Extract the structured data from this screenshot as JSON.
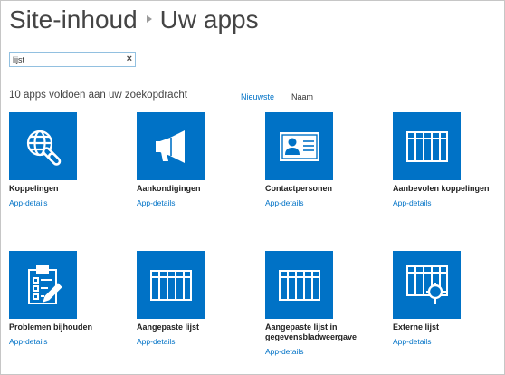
{
  "breadcrumb": {
    "parent": "Site-inhoud",
    "current": "Uw apps"
  },
  "search": {
    "value": "lijst",
    "clear_glyph": "×"
  },
  "results": {
    "count_text": "10 apps voldoen aan uw zoekopdracht",
    "sort_newest": "Nieuwste",
    "sort_name": "Naam"
  },
  "tiles": [
    {
      "name": "Koppelingen",
      "details": "App-details",
      "icon": "globe-link-icon"
    },
    {
      "name": "Aankondigingen",
      "details": "App-details",
      "icon": "megaphone-icon"
    },
    {
      "name": "Contactpersonen",
      "details": "App-details",
      "icon": "contact-card-icon"
    },
    {
      "name": "Aanbevolen koppelingen",
      "details": "App-details",
      "icon": "list-grid-icon"
    },
    {
      "name": "Problemen bijhouden",
      "details": "App-details",
      "icon": "clipboard-checklist-icon"
    },
    {
      "name": "Aangepaste lijst",
      "details": "App-details",
      "icon": "list-grid-icon"
    },
    {
      "name": "Aangepaste lijst in gegevensbladweergave",
      "details": "App-details",
      "icon": "list-grid-icon"
    },
    {
      "name": "Externe lijst",
      "details": "App-details",
      "icon": "external-list-icon"
    }
  ],
  "colors": {
    "tile": "#0072c6",
    "link": "#0072c6"
  }
}
